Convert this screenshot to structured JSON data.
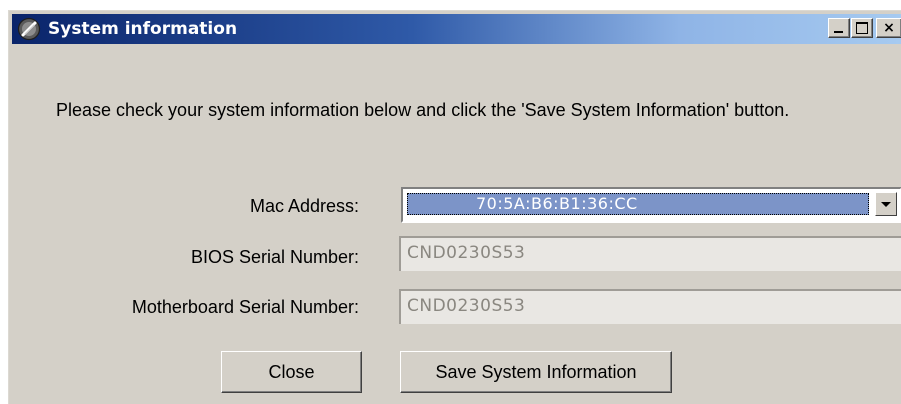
{
  "window": {
    "title": "System information",
    "app_icon": "system-info-app-icon",
    "controls": {
      "minimize": "minimize-icon",
      "maximize": "maximize-icon",
      "close_glyph": "×"
    }
  },
  "instructions": "Please check your system information below and click the 'Save System Information' button.",
  "form": {
    "mac_label": "Mac Address:",
    "mac_value": "70:5A:B6:B1:36:CC",
    "bios_label": "BIOS Serial Number:",
    "bios_value": "CND0230S53",
    "mobo_label": "Motherboard Serial Number:",
    "mobo_value": "CND0230S53"
  },
  "buttons": {
    "close_label": "Close",
    "save_label": "Save System Information"
  },
  "colors": {
    "title_gradient_start": "#0a246a",
    "title_gradient_end": "#a6caf0",
    "window_face": "#d4d0c8",
    "selection": "#7c94c8"
  }
}
